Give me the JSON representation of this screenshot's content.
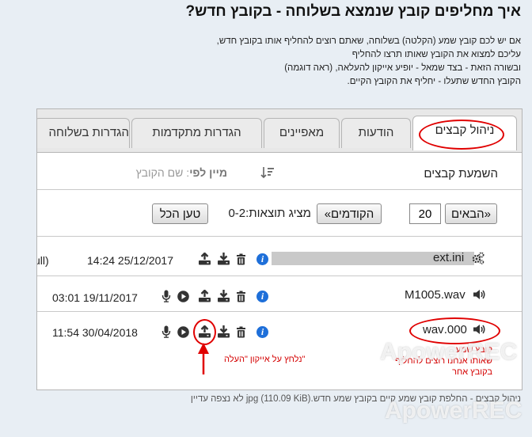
{
  "page": {
    "title": "איך מחליפים קובץ שנמצא בשלוחה - בקובץ חדש?",
    "description": [
      "אם יש לכם קובץ שמע (הקלטה) בשלוחה, שאתם רוצים להחליף אותו בקובץ חדש,",
      "עליכם למצוא את הקובץ שאותו תרצו להחליף",
      "ובשורה הזאת - בצד שמאל - יופיע אייקון להעלאה, (ראה דוגמה)",
      "הקובץ החדש שתעלו - יחליף את הקובץ הקיים."
    ],
    "footer": "ניהול קבצים - החלפת קובץ שמע קיים בקובץ שמע חדש.jpg (110.09 KiB) לא נצפה עדיין",
    "watermarks": [
      "ApowerREC",
      "ApowerREC"
    ]
  },
  "tabs": [
    {
      "label": "ניהול קבצים",
      "active": true
    },
    {
      "label": "הודעות",
      "active": false
    },
    {
      "label": "מאפיינים",
      "active": false
    },
    {
      "label": "הגדרות מתקדמות",
      "active": false
    },
    {
      "label": "הגדרות בשלוחה",
      "active": false
    }
  ],
  "sort": {
    "audio_label": "השמעת קבצים",
    "sort_by_label": "מיין לפי",
    "sort_value": ": שם הקובץ"
  },
  "pager": {
    "next_label": "«הבאים",
    "page_size": "20",
    "prev_label": "הקודמים»",
    "results_label": "מציג תוצאות:",
    "results_range": "0-2",
    "load_all_label": "טען הכל"
  },
  "files": [
    {
      "name": "ext.ini",
      "date": "14:24 25/12/2017",
      "extra": "(null",
      "type": "settings"
    },
    {
      "name": "M1005.wav",
      "date": "03:01 19/11/2017",
      "type": "audio"
    },
    {
      "name": "000.wav",
      "date": "11:54 30/04/2018",
      "type": "audio"
    }
  ],
  "annotations": {
    "click_upload": "\"נלחץ על אייקון \"העלה",
    "file_note": [
      "קובץ שמע",
      "שאותו אנחנו רוצים להחליף",
      "בקובץ אחר"
    ]
  },
  "colors": {
    "accent_red": "#e00000",
    "info_blue": "#1e6fd9"
  }
}
